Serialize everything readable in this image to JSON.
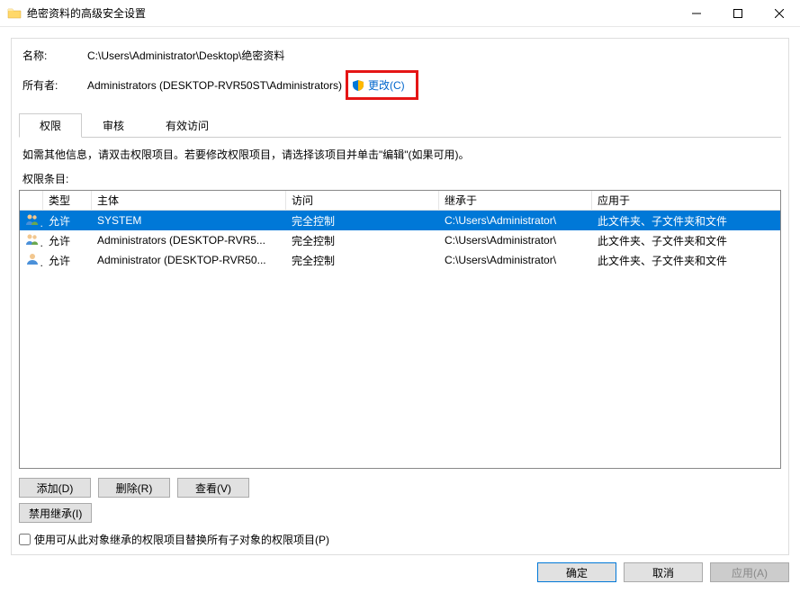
{
  "window": {
    "title": "绝密资料的高级安全设置"
  },
  "info": {
    "name_label": "名称:",
    "name_value": "C:\\Users\\Administrator\\Desktop\\绝密资料",
    "owner_label": "所有者:",
    "owner_value": "Administrators (DESKTOP-RVR50ST\\Administrators)",
    "change_link": "更改(C)"
  },
  "tabs": [
    {
      "label": "权限",
      "active": true
    },
    {
      "label": "审核",
      "active": false
    },
    {
      "label": "有效访问",
      "active": false
    }
  ],
  "help_text": "如需其他信息，请双击权限项目。若要修改权限项目，请选择该项目并单击\"编辑\"(如果可用)。",
  "entries_label": "权限条目:",
  "table": {
    "headers": {
      "type": "类型",
      "principal": "主体",
      "access": "访问",
      "inherit": "继承于",
      "applies": "应用于"
    },
    "rows": [
      {
        "icon": "users",
        "type": "允许",
        "principal": "SYSTEM",
        "access": "完全控制",
        "inherit": "C:\\Users\\Administrator\\",
        "applies": "此文件夹、子文件夹和文件",
        "selected": true
      },
      {
        "icon": "users",
        "type": "允许",
        "principal": "Administrators (DESKTOP-RVR5...",
        "access": "完全控制",
        "inherit": "C:\\Users\\Administrator\\",
        "applies": "此文件夹、子文件夹和文件",
        "selected": false
      },
      {
        "icon": "user",
        "type": "允许",
        "principal": "Administrator (DESKTOP-RVR50...",
        "access": "完全控制",
        "inherit": "C:\\Users\\Administrator\\",
        "applies": "此文件夹、子文件夹和文件",
        "selected": false
      }
    ]
  },
  "buttons": {
    "add": "添加(D)",
    "remove": "删除(R)",
    "view": "查看(V)",
    "disable_inherit": "禁用继承(I)"
  },
  "checkbox": {
    "label": "使用可从此对象继承的权限项目替换所有子对象的权限项目(P)"
  },
  "footer": {
    "ok": "确定",
    "cancel": "取消",
    "apply": "应用(A)"
  }
}
